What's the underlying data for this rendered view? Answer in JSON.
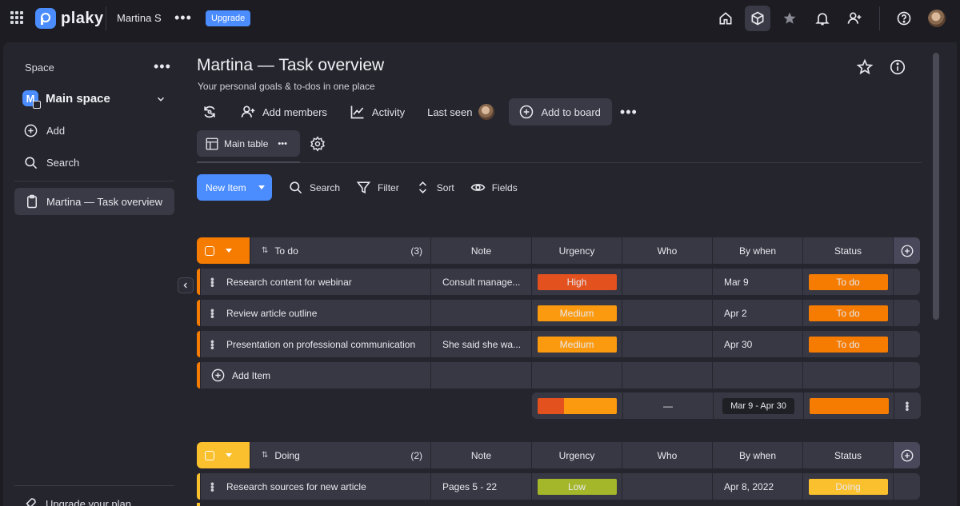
{
  "topbar": {
    "logo_text": "plaky",
    "user_name": "Martina S",
    "upgrade_label": "Upgrade",
    "icons": [
      "home-icon",
      "cube-icon",
      "star-icon",
      "bell-icon",
      "add-user-icon",
      "help-icon",
      "avatar"
    ]
  },
  "sidebar": {
    "space_label": "Space",
    "space_initial": "M",
    "main_space_label": "Main space",
    "add_label": "Add",
    "search_label": "Search",
    "board_label": "Martina — Task overview",
    "upgrade_plan_label": "Upgrade your plan"
  },
  "board": {
    "title": "Martina — Task overview",
    "subtitle": "Your personal goals & to-dos in one place",
    "add_members_label": "Add members",
    "activity_label": "Activity",
    "last_seen_label": "Last seen",
    "add_to_board_label": "Add to board",
    "view_tab_label": "Main table"
  },
  "toolbar": {
    "new_item_label": "New Item",
    "search_label": "Search",
    "filter_label": "Filter",
    "sort_label": "Sort",
    "fields_label": "Fields"
  },
  "columns": [
    "Note",
    "Urgency",
    "Who",
    "By when",
    "Status"
  ],
  "groups": [
    {
      "name": "To do",
      "count": "(3)",
      "color": "#f57c00",
      "items": [
        {
          "name": "Research content for webinar",
          "note": "Consult manage...",
          "urgency": "High",
          "urgency_color": "#e3511e",
          "date": "Mar 9",
          "status": "To do",
          "status_color": "#f57c00"
        },
        {
          "name": "Review article outline",
          "note": "",
          "urgency": "Medium",
          "urgency_color": "#fb9a0e",
          "date": "Apr 2",
          "status": "To do",
          "status_color": "#f57c00"
        },
        {
          "name": "Presentation on professional communication",
          "note": "She said she wa...",
          "urgency": "Medium",
          "urgency_color": "#fb9a0e",
          "date": "Apr 30",
          "status": "To do",
          "status_color": "#f57c00"
        }
      ],
      "add_item_label": "Add Item",
      "summary": {
        "who": "—",
        "date_range": "Mar 9 - Apr 30",
        "urgency_split": [
          0.33,
          0.67
        ],
        "urgency_colors": [
          "#e3511e",
          "#fb9a0e"
        ],
        "status_color": "#f57c00"
      }
    },
    {
      "name": "Doing",
      "count": "(2)",
      "color": "#fbc02d",
      "items": [
        {
          "name": "Research sources for new article",
          "note": "Pages 5 - 22",
          "urgency": "Low",
          "urgency_color": "#a4b72a",
          "date": "Apr 8, 2022",
          "status": "Doing",
          "status_color": "#fbc02d"
        }
      ]
    }
  ]
}
